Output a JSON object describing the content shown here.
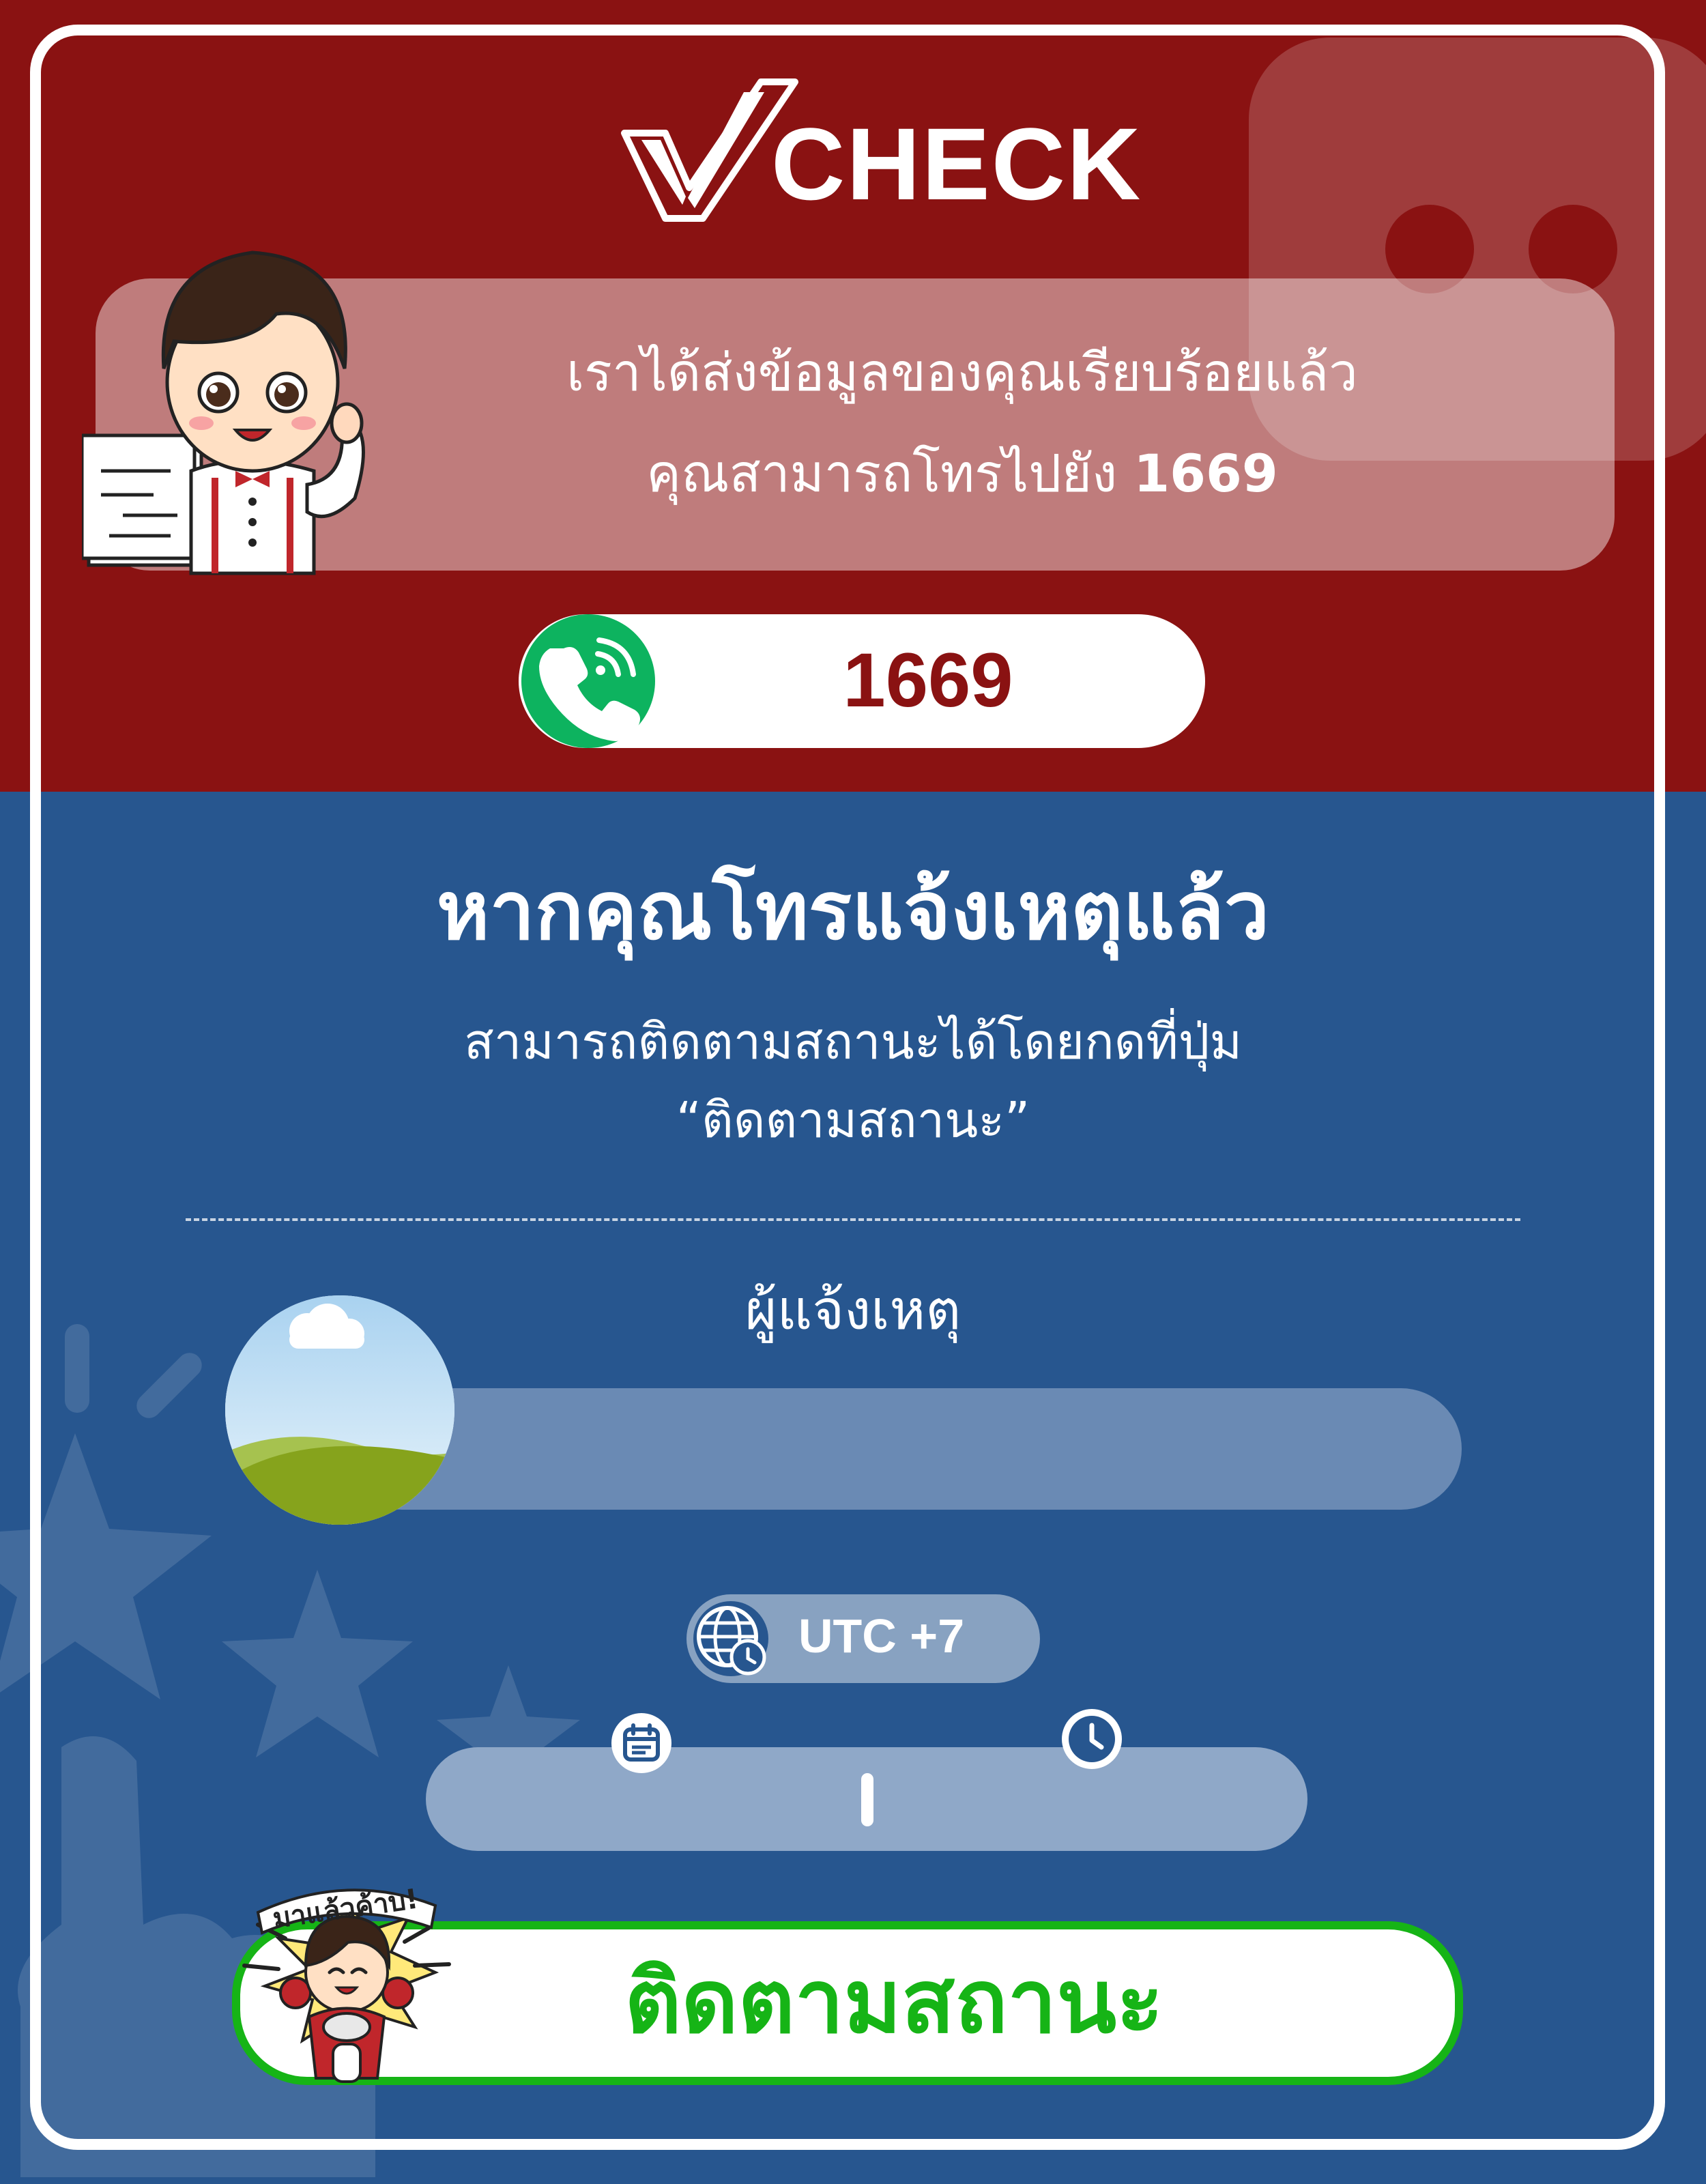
{
  "brand": {
    "logo_text": "CHECK"
  },
  "message": {
    "line1": "เราได้ส่งข้อมูลของคุณเรียบร้อยแล้ว",
    "line2_prefix": "คุณสามารถโทรไปยัง ",
    "line2_number": "1669"
  },
  "call": {
    "number": "1669",
    "icon": "phone-call-icon"
  },
  "followup": {
    "heading": "หากคุณโทรแจ้งเหตุแล้ว",
    "sub1": "สามารถติดตามสถานะได้โดยกดที่ปุ่ม",
    "sub2": "“ติดตามสถานะ”"
  },
  "reporter": {
    "label": "ผู้แจ้งเหตุ",
    "name": ""
  },
  "timezone": {
    "label": "UTC +7",
    "icon": "globe-clock-icon"
  },
  "datetime": {
    "date": "",
    "time": "",
    "date_icon": "calendar-icon",
    "time_icon": "clock-icon"
  },
  "track_button": {
    "label": "ติดตามสถานะ"
  },
  "mascot_badge": {
    "text": "มาแล้วค้าบ!"
  },
  "colors": {
    "top_bg": "#8a1212",
    "bottom_bg": "#27568f",
    "call_green": "#0db35f",
    "track_green": "#16b416"
  }
}
